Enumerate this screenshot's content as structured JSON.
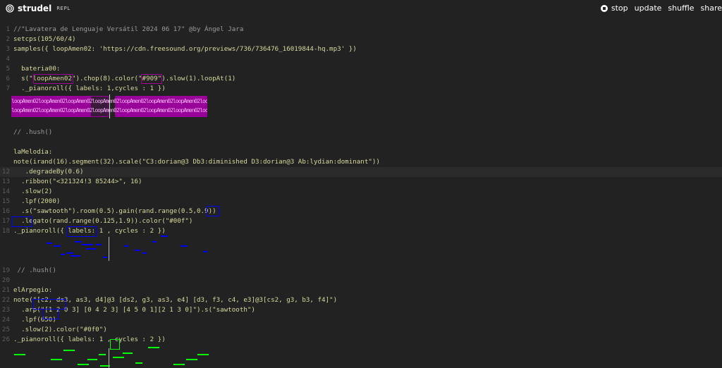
{
  "app": {
    "name": "strudel",
    "tag": "REPL",
    "logo_icon": "spiral-logo-icon"
  },
  "nav": {
    "stop": "stop",
    "update": "update",
    "shuffle": "shuffle",
    "share": "share"
  },
  "colors": {
    "background": "#222222",
    "magenta": "#990099",
    "blue": "#0000ff",
    "green": "#00ff00"
  },
  "lines": [
    {
      "n": "1",
      "text": "//\"Lavatera de Lenguaje Versátil 2024 06 17\" @by Ángel Jara"
    },
    {
      "n": "2",
      "text": "setcps(105/60/4)"
    },
    {
      "n": "3",
      "text": "samples({ loopAmen02: 'https://cdn.freesound.org/previews/736/736476_16019844-hq.mp3' })"
    },
    {
      "n": "4",
      "text": ""
    },
    {
      "n": "5",
      "text": "  bateria00:"
    },
    {
      "n": "6",
      "text": "  s(\"loopAmen02\").chop(8).color(\"#909\").slow(1).loopAt(1)"
    },
    {
      "n": "7",
      "text": "  ._pianoroll({ labels: 1,cycles : 1 })"
    },
    {
      "n": "",
      "text": ""
    },
    {
      "n": "",
      "text": ""
    },
    {
      "n": "",
      "text": ""
    },
    {
      "n": "",
      "text": "// .hush()"
    },
    {
      "n": "",
      "text": ""
    },
    {
      "n": "",
      "text": "laMelodia:"
    },
    {
      "n": "",
      "text": "note(irand(16).segment(32).scale(\"C3:dorian@3 Db3:diminished D3:dorian@3 Ab:lydian:dominant\"))"
    },
    {
      "n": "12",
      "text": "   .degradeBy(0.6)"
    },
    {
      "n": "13",
      "text": "  .ribbon(\"<321324!3 85244>\", 16)"
    },
    {
      "n": "14",
      "text": "  .slow(2)"
    },
    {
      "n": "15",
      "text": "  .lpf(2000)"
    },
    {
      "n": "16",
      "text": "  .s(\"sawtooth\").room(0.5).gain(rand.range(0.5,0.9))"
    },
    {
      "n": "17",
      "text": "  .legato(rand.range(0.125,1.9)).color(\"#00f\")"
    },
    {
      "n": "18",
      "text": "._pianoroll({ labels: 1 , cycles : 2 })"
    },
    {
      "n": "",
      "text": ""
    },
    {
      "n": "",
      "text": ""
    },
    {
      "n": "",
      "text": ""
    },
    {
      "n": "19",
      "text": " // .hush()"
    },
    {
      "n": "20",
      "text": ""
    },
    {
      "n": "21",
      "text": "elArpegio:"
    },
    {
      "n": "22",
      "text": "note(\"[c2, ds3, as3, d4]@3 [ds2, g3, as3, e4] [d3, f3, c4, e3]@3[cs2, g3, b3, f4]\")"
    },
    {
      "n": "23",
      "text": "  .arp(\"[1 2 0 3] [0 4 2 3] [4 5 0 1][2 1 3 0]\").s(\"sawtooth\")"
    },
    {
      "n": "24",
      "text": "  .lpf(650)"
    },
    {
      "n": "25",
      "text": "  .slow(2).color(\"#0f0\")"
    },
    {
      "n": "26",
      "text": "._pianoroll({ labels: 1 , cycles : 2 })"
    }
  ],
  "drum_label": "loopAmen02"
}
